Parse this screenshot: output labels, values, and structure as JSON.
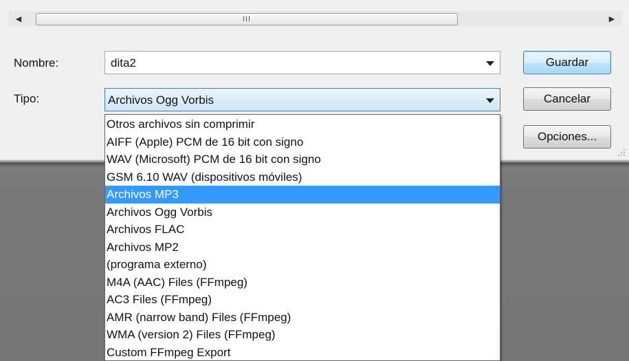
{
  "scrollbar": {
    "left_arrow": "◀",
    "right_arrow": "▶",
    "thumb_grip": "III"
  },
  "form": {
    "nombre_label": "Nombre:",
    "nombre_value": "dita2",
    "tipo_label": "Tipo:",
    "tipo_value": "Archivos Ogg Vorbis"
  },
  "buttons": {
    "guardar": "Guardar",
    "cancelar": "Cancelar",
    "opciones": "Opciones..."
  },
  "dropdown": {
    "selected_index": 4,
    "options": [
      "Otros archivos sin comprimir",
      "AIFF (Apple) PCM de 16 bit con signo",
      "WAV (Microsoft) PCM de 16 bit con signo",
      "GSM 6.10 WAV (dispositivos móviles)",
      "Archivos MP3",
      "Archivos Ogg Vorbis",
      "Archivos FLAC",
      "Archivos MP2",
      "(programa externo)",
      "M4A (AAC) Files (FFmpeg)",
      "AC3 Files (FFmpeg)",
      "AMR (narrow band) Files (FFmpeg)",
      "WMA (version 2) Files (FFmpeg)",
      "Custom FFmpeg Export"
    ]
  },
  "colors": {
    "highlight": "#3399ff",
    "dialog_bg": "#f0f0f0",
    "backdrop": "#787878"
  }
}
